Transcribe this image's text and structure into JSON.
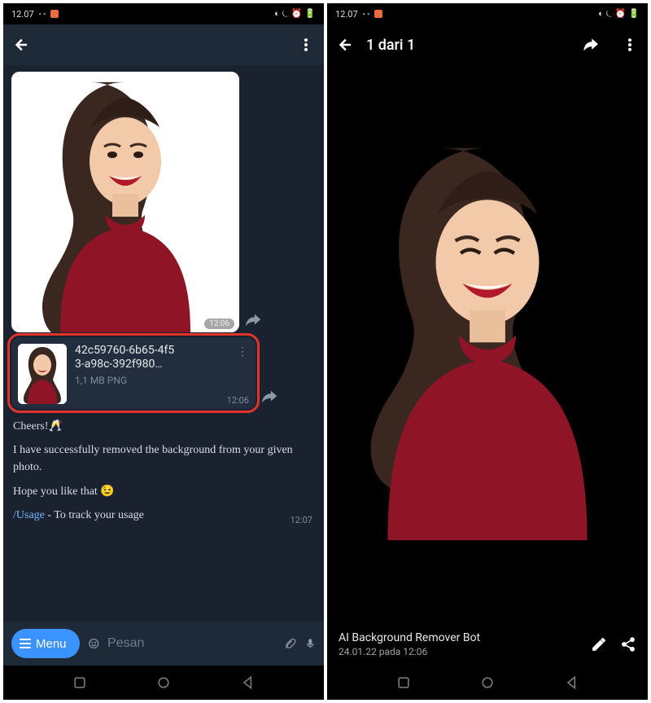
{
  "status": {
    "time": "12.07",
    "right_glyphs": "◐ ⏾ ⏰ 🔋"
  },
  "chat": {
    "image_time": "12:06",
    "file": {
      "name_line1": "42c59760-6b65-4f5",
      "name_line2": "3-a98c-392f980…",
      "size": "1,1 MB PNG",
      "time": "12:06"
    },
    "bot": {
      "line1": "Cheers!",
      "champagne": "🥂",
      "line2": "I have successfully removed the background from your given photo.",
      "line3": "Hope you like that",
      "wink": "😉",
      "usage_cmd": "/Usage",
      "usage_rest": " - To track your usage",
      "time": "12:07"
    }
  },
  "input": {
    "menu": "Menu",
    "placeholder": "Pesan"
  },
  "viewer": {
    "counter": "1 dari 1",
    "caption_title": "AI Background Remover Bot",
    "caption_sub": "24.01.22 pada 12:06"
  }
}
